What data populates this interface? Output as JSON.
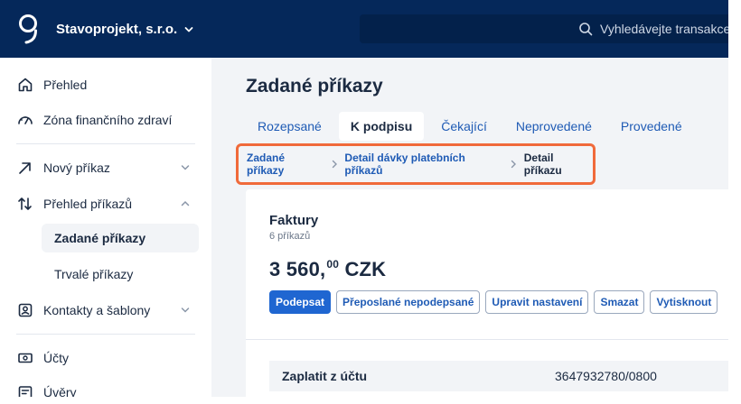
{
  "header": {
    "company": "Stavoprojekt, s.r.o.",
    "search_placeholder": "Vyhledávejte transakce"
  },
  "sidebar": {
    "items": [
      {
        "label": "Přehled",
        "icon": "home-icon"
      },
      {
        "label": "Zóna finančního zdraví",
        "icon": "gauge-icon"
      },
      {
        "label": "Nový příkaz",
        "icon": "arrow-up-right-icon"
      },
      {
        "label": "Přehled příkazů",
        "icon": "transfer-arrows-icon"
      },
      {
        "label": "Kontakty a šablony",
        "icon": "contact-icon"
      },
      {
        "label": "Účty",
        "icon": "banknote-icon"
      },
      {
        "label": "Úvěry",
        "icon": "loan-icon"
      }
    ],
    "sub_items": [
      {
        "label": "Zadané příkazy",
        "active": true
      },
      {
        "label": "Trvalé příkazy",
        "active": false
      }
    ]
  },
  "main": {
    "title": "Zadané příkazy",
    "tabs": [
      "Rozepsané",
      "K podpisu",
      "Čekající",
      "Neprovedené",
      "Provedené"
    ],
    "active_tab": "K podpisu",
    "breadcrumb": [
      "Zadané příkazy",
      "Detail dávky platebních příkazů",
      "Detail příkazu"
    ]
  },
  "card": {
    "title": "Faktury",
    "subtitle": "6 příkazů",
    "amount_main": "3 560,",
    "amount_decimals": "00",
    "currency": "CZK",
    "buttons": {
      "sign": "Podepsat",
      "forwarded": "Přeposlané nepodepsané",
      "edit": "Upravit nastavení",
      "delete": "Smazat",
      "print": "Vytisknout"
    },
    "row_label": "Zaplatit z účtu",
    "row_value": "3647932780/0800"
  },
  "colors": {
    "topbar": "#05285a",
    "accent": "#1f66d1",
    "highlight": "#f06a3a"
  }
}
